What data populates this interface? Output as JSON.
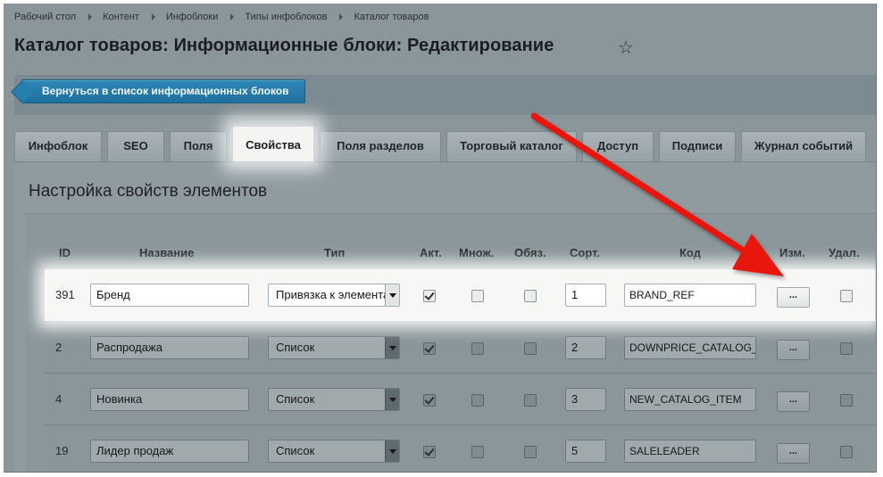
{
  "breadcrumb": [
    "Рабочий стол",
    "Контент",
    "Инфоблоки",
    "Типы инфоблоков",
    "Каталог товаров"
  ],
  "page_title": "Каталог товаров: Информационные блоки: Редактирование",
  "back_button": "Вернуться в список информационных блоков",
  "tabs": [
    {
      "label": "Инфоблок"
    },
    {
      "label": "SEO"
    },
    {
      "label": "Поля"
    },
    {
      "label": "Свойства",
      "active": true
    },
    {
      "label": "Поля разделов"
    },
    {
      "label": "Торговый каталог"
    },
    {
      "label": "Доступ"
    },
    {
      "label": "Подписи"
    },
    {
      "label": "Журнал событий"
    }
  ],
  "section_title": "Настройка свойств элементов",
  "table": {
    "headers": {
      "id": "ID",
      "name": "Название",
      "type": "Тип",
      "active": "Акт.",
      "multiple": "Множ.",
      "required": "Обяз.",
      "sort": "Сорт.",
      "code": "Код",
      "edit": "Изм.",
      "delete": "Удал."
    },
    "edit_label": "...",
    "rows": [
      {
        "id": "391",
        "name": "Бренд",
        "type": "Привязка к элементам",
        "active": true,
        "multiple": false,
        "required": false,
        "sort": "1",
        "code": "BRAND_REF",
        "delete": false
      },
      {
        "id": "2",
        "name": "Распродажа",
        "type": "Список",
        "active": true,
        "multiple": false,
        "required": false,
        "sort": "2",
        "code": "DOWNPRICE_CATALOG_ITEM",
        "delete": false
      },
      {
        "id": "4",
        "name": "Новинка",
        "type": "Список",
        "active": true,
        "multiple": false,
        "required": false,
        "sort": "3",
        "code": "NEW_CATALOG_ITEM",
        "delete": false
      },
      {
        "id": "19",
        "name": "Лидер продаж",
        "type": "Список",
        "active": true,
        "multiple": false,
        "required": false,
        "sort": "5",
        "code": "SALELEADER",
        "delete": false
      }
    ]
  },
  "colors": {
    "accent": "#2580b0",
    "arrow": "#e8180c"
  },
  "icons": {
    "favorite": "star-icon",
    "annotation": "red-arrow-icon"
  }
}
